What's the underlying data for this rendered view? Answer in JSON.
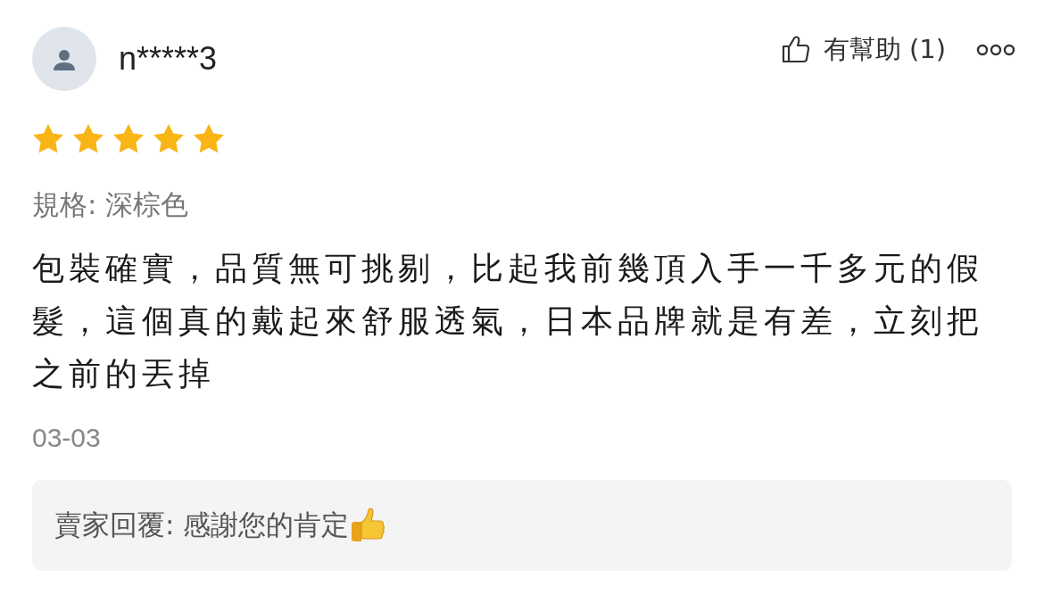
{
  "review": {
    "username": "n*****3",
    "helpful_label": "有幫助 (1)",
    "stars": 5,
    "spec": "規格: 深棕色",
    "text": "包裝確實，品質無可挑剔，比起我前幾頂入手一千多元的假髮，這個真的戴起來舒服透氣，日本品牌就是有差，立刻把之前的丟掉",
    "date": "03-03"
  },
  "seller_reply": {
    "text": "賣家回覆: 感謝您的肯定"
  }
}
